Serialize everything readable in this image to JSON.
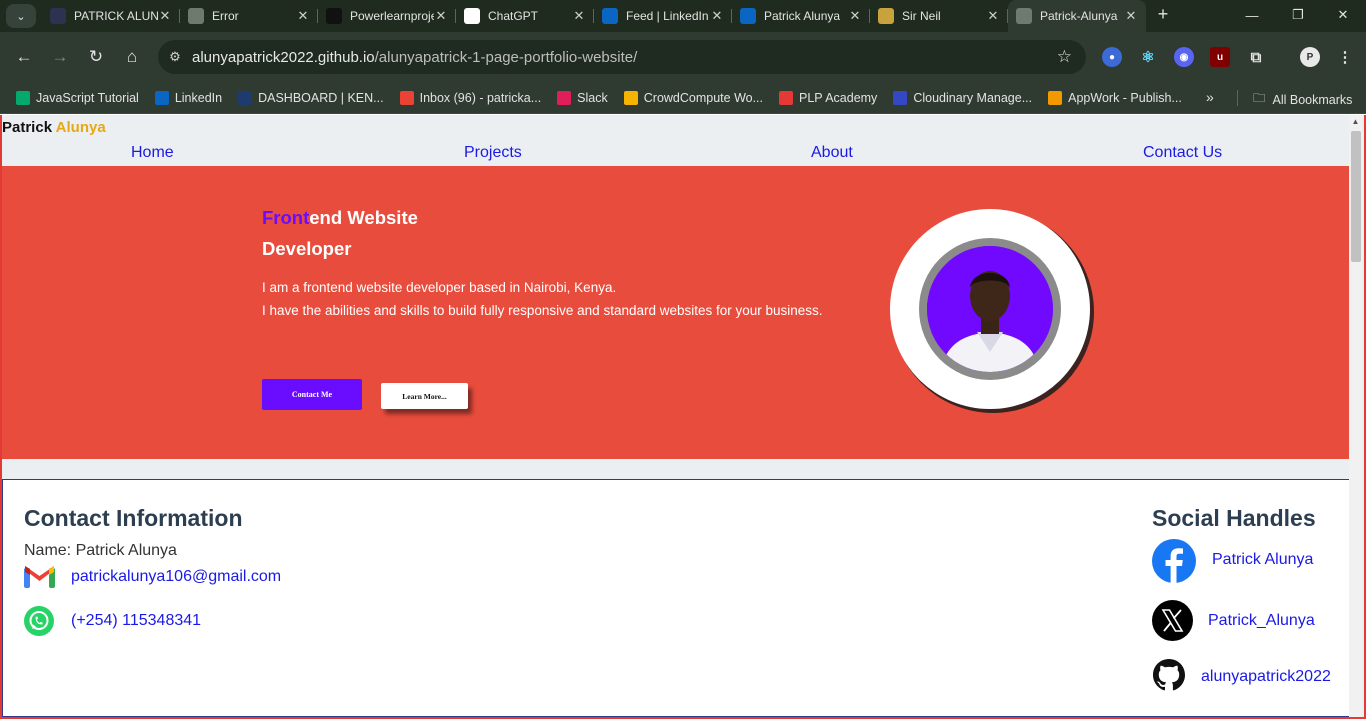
{
  "browser": {
    "tabs": [
      {
        "title": "PATRICK ALUNYA",
        "icon": "github-octocat-icon",
        "color": "#2b3350"
      },
      {
        "title": "Error",
        "icon": "globe-icon",
        "color": "#6d7a6e"
      },
      {
        "title": "Powerlearnproject",
        "icon": "github-icon",
        "color": "#111111"
      },
      {
        "title": "ChatGPT",
        "icon": "chatgpt-icon",
        "color": "#ffffff"
      },
      {
        "title": "Feed | LinkedIn",
        "icon": "linkedin-icon",
        "color": "#0a66c2"
      },
      {
        "title": "Patrick Alunya",
        "icon": "linkedin-icon",
        "color": "#0a66c2"
      },
      {
        "title": "Sir Neil",
        "icon": "sir-neil-icon",
        "color": "#c8a23a"
      },
      {
        "title": "Patrick-Alunya",
        "icon": "globe-icon",
        "color": "#6d7a6e",
        "active": true
      }
    ],
    "url_host": "alunyapatrick2022.github.io",
    "url_path": "/alunyapatrick-1-page-portfolio-website/",
    "bookmarks": [
      {
        "label": "JavaScript Tutorial",
        "icon": "w3schools-icon",
        "color": "#04aa6d"
      },
      {
        "label": "LinkedIn",
        "icon": "linkedin-icon",
        "color": "#0a66c2"
      },
      {
        "label": "DASHBOARD | KEN...",
        "icon": "dashboard-icon",
        "color": "#1d3b6e"
      },
      {
        "label": "Inbox (96) - patricka...",
        "icon": "gmail-icon",
        "color": "#ea4335"
      },
      {
        "label": "Slack",
        "icon": "slack-icon",
        "color": "#e01e5a"
      },
      {
        "label": "CrowdCompute Wo...",
        "icon": "crowdcompute-icon",
        "color": "#f4b400"
      },
      {
        "label": "PLP Academy",
        "icon": "plp-icon",
        "color": "#e53935"
      },
      {
        "label": "Cloudinary Manage...",
        "icon": "cloudinary-icon",
        "color": "#3448c5"
      },
      {
        "label": "AppWork - Publish...",
        "icon": "appwork-icon",
        "color": "#f29900"
      }
    ],
    "all_bookmarks_label": "All Bookmarks"
  },
  "site": {
    "brand_first": "Patrick",
    "brand_last": "Alunya",
    "nav": [
      "Home",
      "Projects",
      "About",
      "Contact Us"
    ],
    "hero": {
      "title_highlight": "Front",
      "title_rest": "end Website",
      "title_line2": "Developer",
      "line1": "I am a frontend website developer based in Nairobi, Kenya.",
      "line2": "I have the abilities and skills to build fully responsive and standard websites for your business.",
      "contact_button": "Contact Me",
      "learn_button": "Learn More..."
    },
    "contact": {
      "heading": "Contact Information",
      "name": "Name: Patrick Alunya",
      "email": "patrickalunya106@gmail.com",
      "phone": "(+254) 115348341"
    },
    "social": {
      "heading": "Social Handles",
      "facebook": "Patrick Alunya",
      "twitter": "Patrick_Alunya",
      "github": "alunyapatrick2022"
    }
  },
  "colors": {
    "hero_bg": "#e84c3d",
    "accent_purple": "#6a0dff",
    "brand_accent": "#e6a817",
    "link_blue": "#1a1ae6"
  }
}
